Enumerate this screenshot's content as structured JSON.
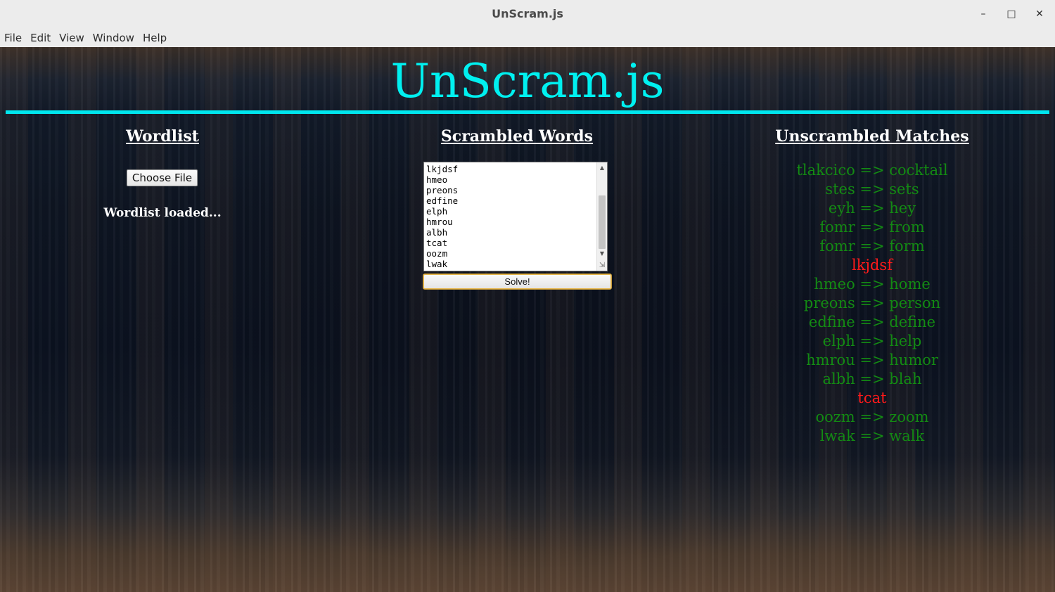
{
  "window": {
    "title": "UnScram.js",
    "controls": {
      "minimize": "–",
      "maximize": "□",
      "close": "✕"
    }
  },
  "menubar": {
    "items": [
      "File",
      "Edit",
      "View",
      "Window",
      "Help"
    ]
  },
  "page": {
    "title": "UnScram.js",
    "accent_color": "#00f0f0"
  },
  "wordlist": {
    "heading": "Wordlist",
    "choose_file_label": "Choose File",
    "status": "Wordlist loaded..."
  },
  "scrambled": {
    "heading": "Scrambled Words",
    "visible_lines": [
      "lkjdsf",
      "hmeo",
      "preons",
      "edfine",
      "elph",
      "hmrou",
      "albh",
      "tcat",
      "oozm",
      "lwak"
    ],
    "solve_label": "Solve!"
  },
  "matches": {
    "heading": "Unscrambled Matches",
    "items": [
      {
        "text": "tlakcico => cocktail",
        "status": "ok"
      },
      {
        "text": "stes => sets",
        "status": "ok"
      },
      {
        "text": "eyh => hey",
        "status": "ok"
      },
      {
        "text": "fomr => from",
        "status": "ok"
      },
      {
        "text": "fomr => form",
        "status": "ok"
      },
      {
        "text": "lkjdsf",
        "status": "fail"
      },
      {
        "text": "hmeo => home",
        "status": "ok"
      },
      {
        "text": "preons => person",
        "status": "ok"
      },
      {
        "text": "edfine => define",
        "status": "ok"
      },
      {
        "text": "elph => help",
        "status": "ok"
      },
      {
        "text": "hmrou => humor",
        "status": "ok"
      },
      {
        "text": "albh => blah",
        "status": "ok"
      },
      {
        "text": "tcat",
        "status": "fail"
      },
      {
        "text": "oozm => zoom",
        "status": "ok"
      },
      {
        "text": "lwak => walk",
        "status": "ok"
      }
    ],
    "colors": {
      "ok": "#138a13",
      "fail": "#ff1a1a"
    }
  }
}
